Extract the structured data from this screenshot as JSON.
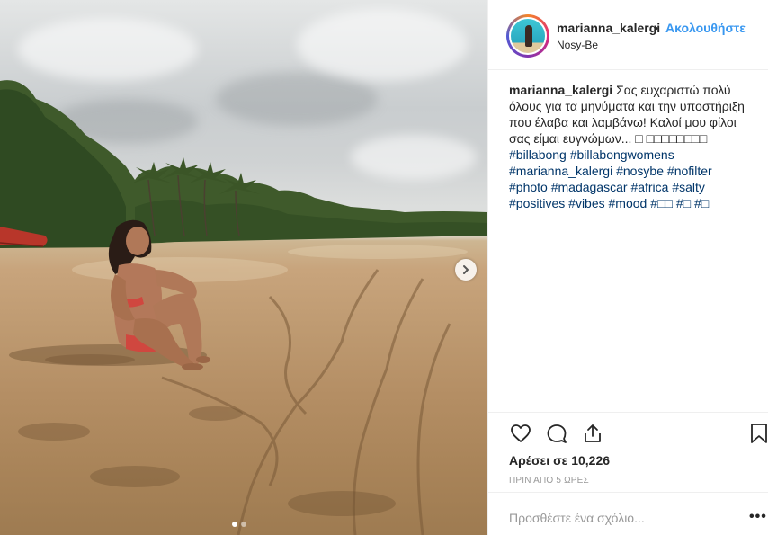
{
  "post": {
    "username": "marianna_kalergi",
    "separator": "•",
    "follow_label": "Ακολουθήστε",
    "location": "Nosy-Be"
  },
  "caption": {
    "username": "marianna_kalergi",
    "text": "Σας ευχαριστώ πολύ όλους για τα μηνύματα και την υποστήριξη που έλαβα και λαμβάνω! Καλοί μου φίλοι σας είμαι ευγνώμων... □ □□□□□□□□",
    "hashtags_line1": [
      "#billabong"
    ],
    "hashtags": [
      "#billabongwomens",
      "#marianna_kalergi",
      "#nosybe",
      "#nofilter",
      "#photo",
      "#madagascar",
      "#africa",
      "#salty",
      "#positives",
      "#vibes",
      "#mood",
      "#□□",
      "#□",
      "#□"
    ]
  },
  "actions": {
    "like_icon": "heart-icon",
    "comment_icon": "comment-icon",
    "share_icon": "share-icon",
    "save_icon": "bookmark-icon",
    "likes_label": "Αρέσει σε 10,226",
    "time": "ΠΡΙΝ ΑΠΟ 5 ΩΡΕΣ",
    "comment_placeholder": "Προσθέστε ένα σχόλιο...",
    "more_label": "•••"
  },
  "carousel": {
    "total_slides": 2,
    "active_slide": 1
  },
  "colors": {
    "link": "#3897f0",
    "hashtag": "#003569",
    "muted": "#999999"
  }
}
